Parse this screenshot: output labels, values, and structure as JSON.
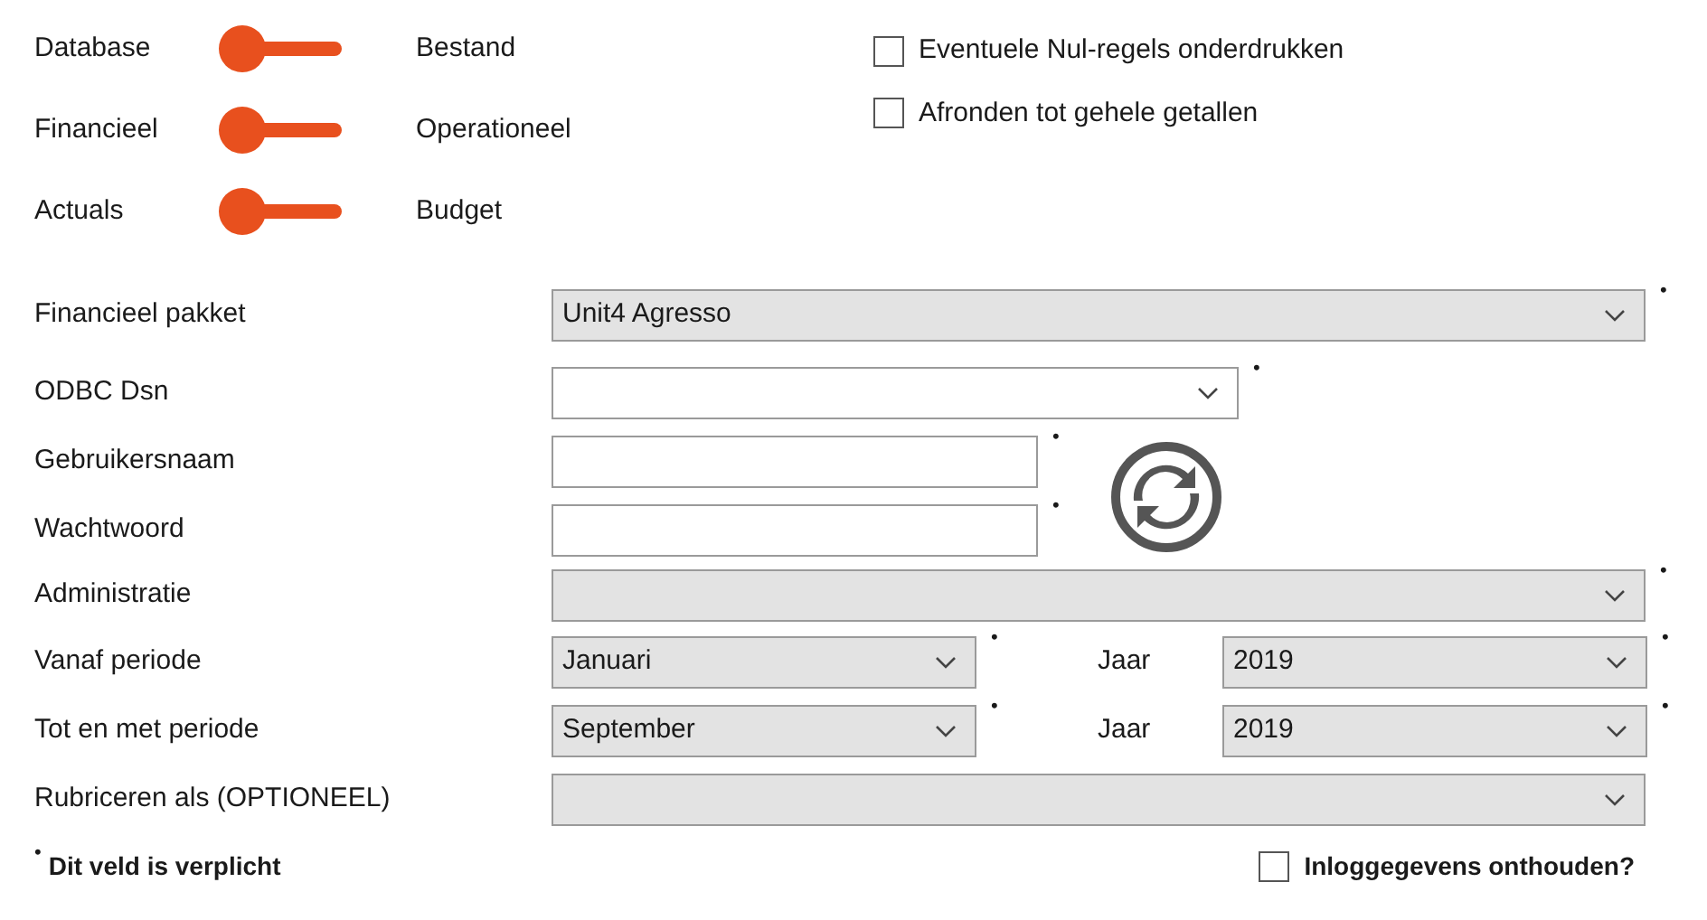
{
  "toggles": [
    {
      "left_label": "Database",
      "right_label": "Bestand",
      "on": false
    },
    {
      "left_label": "Financieel",
      "right_label": "Operationeel",
      "on": false
    },
    {
      "left_label": "Actuals",
      "right_label": "Budget",
      "on": false
    }
  ],
  "options": [
    {
      "label": "Eventuele Nul-regels onderdrukken",
      "checked": false
    },
    {
      "label": "Afronden tot gehele getallen",
      "checked": false
    }
  ],
  "fields": [
    {
      "label": "Financieel pakket",
      "kind": "select",
      "value": "Unit4 Agresso",
      "disabled": true,
      "required_mark": "•"
    },
    {
      "label": "ODBC Dsn",
      "kind": "select",
      "disabled": false,
      "required_mark": "•"
    },
    {
      "label": "Gebruikersnaam",
      "kind": "input",
      "disabled": false,
      "required_mark": "•"
    },
    {
      "label": "Wachtwoord",
      "kind": "input",
      "disabled": false,
      "required_mark": "•"
    },
    {
      "label": "Administratie",
      "kind": "select",
      "disabled": true,
      "required_mark": "•"
    },
    {
      "label": "Vanaf periode",
      "kind": "period",
      "value": "Januari",
      "disabled": true,
      "required_mark": "•",
      "year_label": "Jaar",
      "year_value": "2019",
      "year_required_mark": "•"
    },
    {
      "label": "Tot en met periode",
      "kind": "period",
      "value": "September",
      "disabled": true,
      "required_mark": "•",
      "year_label": "Jaar",
      "year_value": "2019",
      "year_required_mark": "•"
    },
    {
      "label": "Rubriceren als (OPTIONEEL)",
      "kind": "select",
      "disabled": true
    }
  ],
  "footer": {
    "required_note_mark": "•",
    "required_note": "Dit veld is verplicht",
    "remember": {
      "label": "Inloggegevens onthouden?",
      "checked": false
    }
  }
}
